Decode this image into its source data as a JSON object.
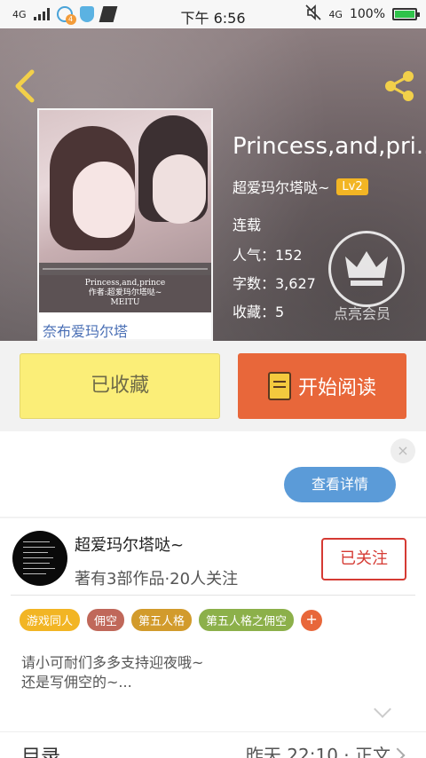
{
  "status_bar": {
    "network": "4G",
    "notification_count": "4",
    "time": "下午 6:56",
    "network_right": "4G",
    "battery": "100%"
  },
  "book": {
    "title": "Princess,and,pri...",
    "cover_caption_line1": "Princess,and,prince",
    "cover_caption_line2": "作者:超爱玛尔塔哒~",
    "cover_caption_line3": "MEITU",
    "cover_name": "奈布爱玛尔塔",
    "author": "超爱玛尔塔哒~",
    "level": "Lv2",
    "status": "连载",
    "popularity": "人气：152",
    "word_count": "字数：3,627",
    "favorites": "收藏：5",
    "vip_label": "点亮会员"
  },
  "actions": {
    "favorite_label": "已收藏",
    "read_label": "开始阅读"
  },
  "ad": {
    "details_label": "查看详情",
    "close_glyph": "×"
  },
  "author_card": {
    "name": "超爱玛尔塔哒~",
    "meta": "著有3部作品·20人关注",
    "follow_label": "已关注",
    "tags": [
      {
        "label": "游戏同人",
        "color": "#f2b524"
      },
      {
        "label": "佣空",
        "color": "#c0685a"
      },
      {
        "label": "第五人格",
        "color": "#d29b2c"
      },
      {
        "label": "第五人格之佣空",
        "color": "#8cb04a"
      }
    ],
    "tag_add": "+",
    "intro_line1": "请小可耐们多多支持迎夜哦~",
    "intro_line2": "还是写佣空的~..."
  },
  "toc": {
    "label": "目录",
    "latest": "昨天 22:10 · 正文"
  },
  "colors": {
    "accent_orange": "#e8673a",
    "accent_yellow": "#fbee78",
    "follow_red": "#d53a33",
    "ad_blue": "#5b9bd8"
  }
}
